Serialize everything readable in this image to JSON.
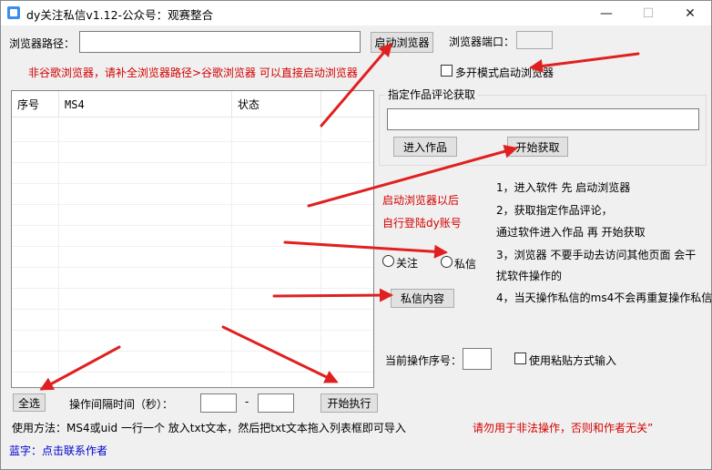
{
  "window": {
    "title": "dy关注私信v1.12-公众号：观赛整合",
    "minimize_glyph": "—",
    "maximize_glyph": "☐",
    "close_glyph": "✕"
  },
  "browser": {
    "path_label": "浏览器路径：",
    "path_value": "",
    "start_button": "启动浏览器",
    "port_label": "浏览器端口：",
    "port_value": "",
    "hint": "非谷歌浏览器，请补全浏览器路径>谷歌浏览器 可以直接启动浏览器",
    "multi_instance_label": "多开模式启动浏览器",
    "multi_instance_checked": false
  },
  "list": {
    "columns": [
      "序号",
      "MS4",
      "状态"
    ],
    "rows": []
  },
  "comments_group": {
    "title": "指定作品评论获取",
    "url_value": "",
    "enter_button": "进入作品",
    "start_button": "开始获取"
  },
  "login_hint": {
    "line1": "启动浏览器以后",
    "line2": "自行登陆dy账号"
  },
  "mode": {
    "follow_label": "关注",
    "message_label": "私信",
    "selected": "none"
  },
  "message_content_button": "私信内容",
  "instructions": [
    "1，进入软件 先 启动浏览器",
    "2，获取指定作品评论，",
    "通过软件进入作品 再 开始获取",
    "3，浏览器 不要手动去访问其他页面 会干",
    "扰软件操作的",
    "4，当天操作私信的ms4不会再重复操作私信"
  ],
  "current_index": {
    "label": "当前操作序号：",
    "value": ""
  },
  "paste_input": {
    "label": "使用粘贴方式输入",
    "checked": false
  },
  "bottom_bar": {
    "select_all": "全选",
    "interval_label": "操作间隔时间（秒）：",
    "interval_from": "",
    "dash": "-",
    "interval_to": "",
    "start_button": "开始执行"
  },
  "usage": "使用方法：MS4或uid 一行一个 放入txt文本，然后把txt文本拖入列表框即可导入",
  "warning": "请勿用于非法操作，否则和作者无关”",
  "contact": "蓝字：点击联系作者",
  "colors": {
    "red_text": "#d40000",
    "blue_link": "#0000d0",
    "arrow": "#e02020",
    "window_bg": "#f0f0f0"
  }
}
